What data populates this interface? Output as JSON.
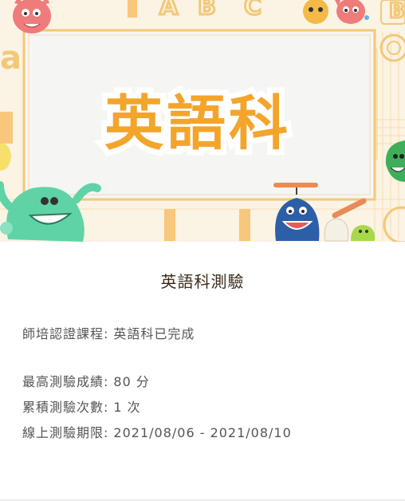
{
  "banner": {
    "logo_text": "英語科",
    "colors": {
      "background": "#fbf3e3",
      "frame": "#f2c879",
      "logo_fill": "#f3a52b",
      "logo_stroke": "#ffffff",
      "panel": "#f5f5f3"
    }
  },
  "course": {
    "title": "英語科測驗",
    "certification_label": "師培認證課程:",
    "certification_value": "英語科已完成",
    "best_score_label": "最高測驗成績:",
    "best_score_value": "80 分",
    "attempts_label": "累積測驗次數:",
    "attempts_value": "1 次",
    "deadline_label": "線上測驗期限:",
    "deadline_value": "2021/08/06 - 2021/08/10"
  }
}
